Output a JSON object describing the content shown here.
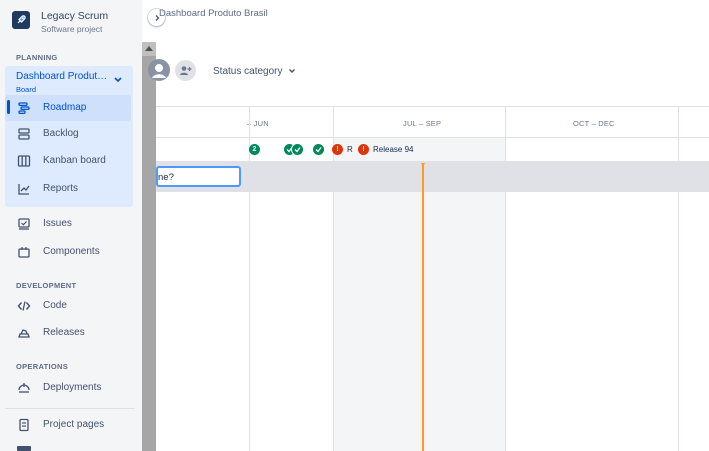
{
  "project": {
    "name": "Legacy Scrum",
    "type": "Software project"
  },
  "sidebar": {
    "planning_title": "PLANNING",
    "board": {
      "name": "Dashboard Produt…",
      "type": "Board"
    },
    "board_items": [
      {
        "label": "Roadmap",
        "icon": "roadmap-icon",
        "selected": true
      },
      {
        "label": "Backlog",
        "icon": "backlog-icon"
      },
      {
        "label": "Kanban board",
        "icon": "kanban-icon"
      },
      {
        "label": "Reports",
        "icon": "reports-icon"
      }
    ],
    "items": [
      {
        "label": "Issues",
        "icon": "issues-icon"
      },
      {
        "label": "Components",
        "icon": "components-icon"
      }
    ],
    "development_title": "DEVELOPMENT",
    "development_items": [
      {
        "label": "Code",
        "icon": "code-icon"
      },
      {
        "label": "Releases",
        "icon": "releases-icon"
      }
    ],
    "operations_title": "OPERATIONS",
    "operations_items": [
      {
        "label": "Deployments",
        "icon": "deployments-icon"
      }
    ],
    "bottom_items": [
      {
        "label": "Project pages",
        "icon": "pages-icon"
      }
    ]
  },
  "main": {
    "breadcrumb": "Dashboard Produto Brasil",
    "status_filter_label": "Status category"
  },
  "timeline": {
    "columns": [
      "– JUN",
      "JUL – SEP",
      "OCT – DEC"
    ],
    "releases": [
      {
        "label": "2",
        "status": "count"
      },
      {
        "label": "R",
        "status": "warning"
      },
      {
        "label": "Release 94",
        "status": "warning"
      }
    ],
    "create_input_value": "ne?"
  },
  "colors": {
    "accent": "#0052cc",
    "selected_bg": "#deebff",
    "today_marker": "#ff991f",
    "release_done": "#00875a",
    "release_warning": "#de350b"
  }
}
